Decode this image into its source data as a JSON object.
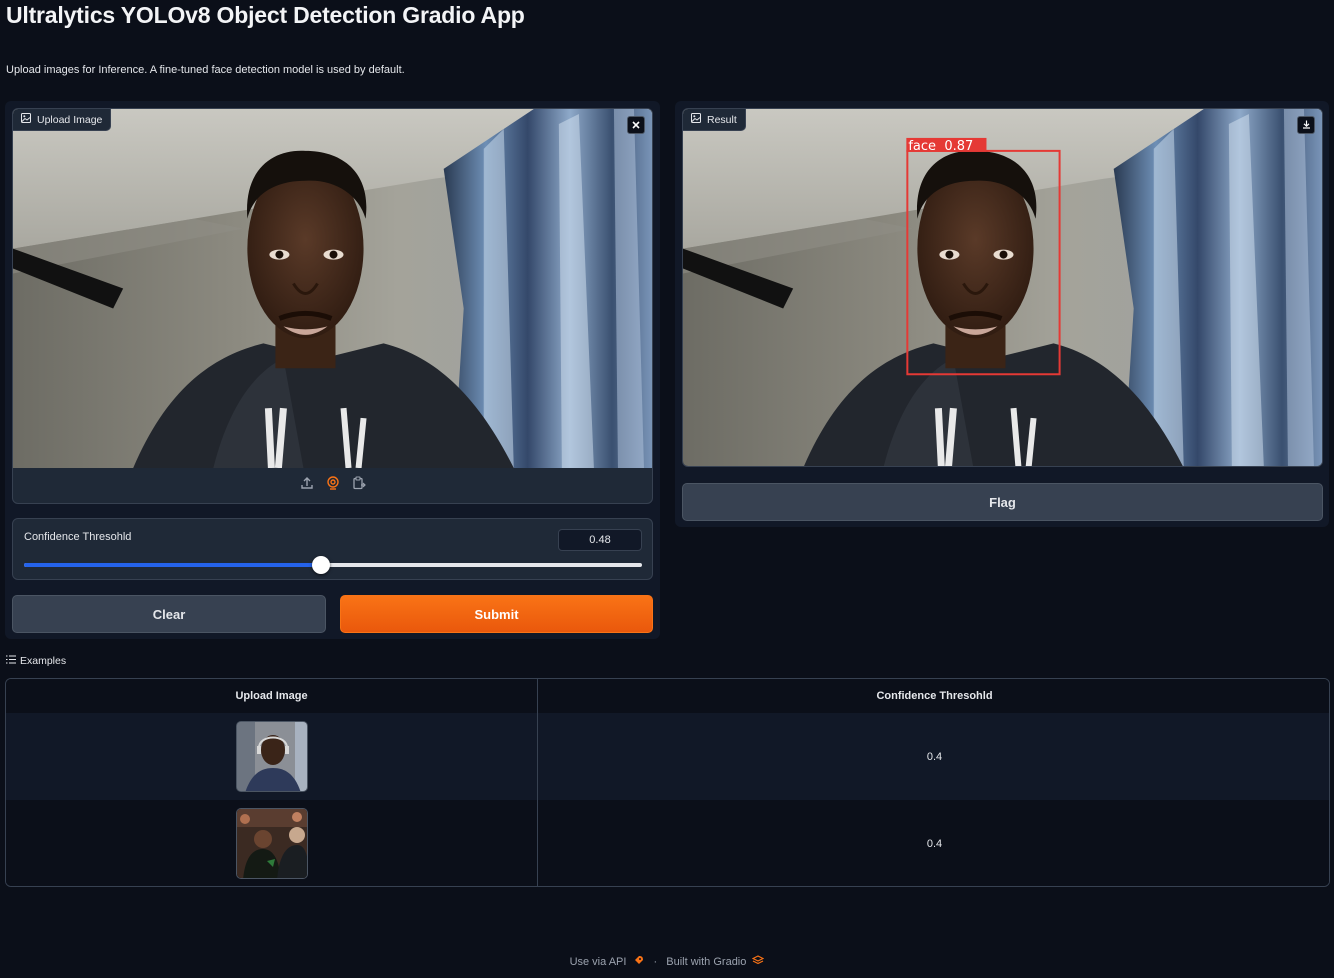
{
  "app": {
    "title": "Ultralytics YOLOv8 Object Detection Gradio App",
    "description": "Upload images for Inference. A fine-tuned face detection model is used by default."
  },
  "input_image": {
    "label": "Upload Image",
    "toolbar_icons": [
      "upload-icon",
      "webcam-icon",
      "clipboard-icon"
    ],
    "clear_icon": "close-icon"
  },
  "slider": {
    "label": "Confidence Thresohld",
    "value": "0.48",
    "fraction": 0.48,
    "fill_color": "#2563eb"
  },
  "buttons": {
    "clear": "Clear",
    "submit": "Submit",
    "flag": "Flag"
  },
  "result": {
    "label": "Result",
    "detection_label": "face  0.87",
    "box_color": "#e53935",
    "download_icon": "download-icon"
  },
  "examples": {
    "label": "Examples",
    "columns": [
      "Upload Image",
      "Confidence Thresohld"
    ],
    "rows": [
      {
        "thumbnail": "person-portrait-thumbnail",
        "confidence": "0.4"
      },
      {
        "thumbnail": "group-photo-thumbnail",
        "confidence": "0.4"
      }
    ]
  },
  "footer": {
    "api_text": "Use via API",
    "separator": "·",
    "built_text": "Built with Gradio"
  },
  "colors": {
    "background": "#0b0f19",
    "panel": "#111827",
    "accent": "#f97316"
  }
}
